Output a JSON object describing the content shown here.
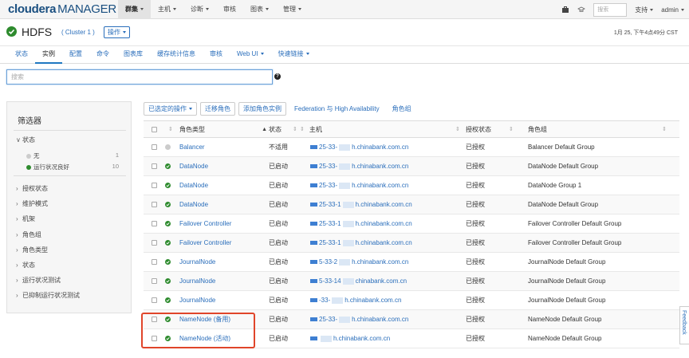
{
  "logo": {
    "brand": "cloudera",
    "product": "MANAGER"
  },
  "topnav": [
    {
      "label": "群集",
      "caret": true,
      "active": true
    },
    {
      "label": "主机",
      "caret": true
    },
    {
      "label": "诊断",
      "caret": true
    },
    {
      "label": "审核",
      "caret": false
    },
    {
      "label": "图表",
      "caret": true
    },
    {
      "label": "管理",
      "caret": true
    }
  ],
  "topright": {
    "search_placeholder": "搜索",
    "support": "支持",
    "user": "admin"
  },
  "service": {
    "name": "HDFS",
    "cluster": "( Cluster 1 )",
    "ops_label": "操作",
    "time": "1月 25, 下午4点49分 CST"
  },
  "subtabs": [
    {
      "label": "状态"
    },
    {
      "label": "实例",
      "active": true
    },
    {
      "label": "配置"
    },
    {
      "label": "命令"
    },
    {
      "label": "图表库"
    },
    {
      "label": "缓存统计信息"
    },
    {
      "label": "审核"
    },
    {
      "label": "Web UI",
      "caret": true
    },
    {
      "label": "快速链接",
      "caret": true
    }
  ],
  "search": {
    "placeholder": "搜索"
  },
  "filter": {
    "title": "筛选器",
    "status_section": "状态",
    "status_items": [
      {
        "label": "无",
        "count": "1"
      },
      {
        "label": "运行状况良好",
        "count": "10"
      }
    ],
    "sections": [
      "授权状态",
      "维护模式",
      "机架",
      "角色组",
      "角色类型",
      "状态",
      "运行状况测试",
      "已抑制运行状况测试"
    ]
  },
  "actions": {
    "selected_ops": "已选定的操作",
    "migrate": "迁移角色",
    "add_instance": "添加角色实例",
    "federation": "Federation 与 High Availability",
    "role_group": "角色组"
  },
  "table": {
    "headers": {
      "role_type": "角色类型",
      "status": "状态",
      "host": "主机",
      "auth": "授权状态",
      "group": "角色组"
    },
    "rows": [
      {
        "icon": "na",
        "role": "Balancer",
        "status": "不适用",
        "host_a": "25-33-",
        "host_b": "h.chinabank.com.cn",
        "auth": "已授权",
        "group": "Balancer Default Group"
      },
      {
        "icon": "ok",
        "role": "DataNode",
        "status": "已启动",
        "host_a": "25-33-",
        "host_b": "h.chinabank.com.cn",
        "auth": "已授权",
        "group": "DataNode Default Group"
      },
      {
        "icon": "ok",
        "role": "DataNode",
        "status": "已启动",
        "host_a": "25-33-",
        "host_b": "h.chinabank.com.cn",
        "auth": "已授权",
        "group": "DataNode Group 1"
      },
      {
        "icon": "ok",
        "role": "DataNode",
        "status": "已启动",
        "host_a": "25-33-1",
        "host_b": "h.chinabank.com.cn",
        "auth": "已授权",
        "group": "DataNode Default Group"
      },
      {
        "icon": "ok",
        "role": "Failover Controller",
        "status": "已启动",
        "host_a": "25-33-1",
        "host_b": "h.chinabank.com.cn",
        "auth": "已授权",
        "group": "Failover Controller Default Group"
      },
      {
        "icon": "ok",
        "role": "Failover Controller",
        "status": "已启动",
        "host_a": "25-33-1",
        "host_b": "h.chinabank.com.cn",
        "auth": "已授权",
        "group": "Failover Controller Default Group"
      },
      {
        "icon": "ok",
        "role": "JournalNode",
        "status": "已启动",
        "host_a": "5-33-2",
        "host_b": "h.chinabank.com.cn",
        "auth": "已授权",
        "group": "JournalNode Default Group"
      },
      {
        "icon": "ok",
        "role": "JournalNode",
        "status": "已启动",
        "host_a": "5-33-14",
        "host_b": "chinabank.com.cn",
        "auth": "已授权",
        "group": "JournalNode Default Group"
      },
      {
        "icon": "ok",
        "role": "JournalNode",
        "status": "已启动",
        "host_a": "-33-",
        "host_b": "h.chinabank.com.cn",
        "auth": "已授权",
        "group": "JournalNode Default Group"
      },
      {
        "icon": "ok",
        "role": "NameNode (备用)",
        "status": "已启动",
        "host_a": "25-33-",
        "host_b": "h.chinabank.com.cn",
        "auth": "已授权",
        "group": "NameNode Default Group"
      },
      {
        "icon": "ok",
        "role": "NameNode (活动)",
        "status": "已启动",
        "host_a": "",
        "host_b": "h.chinabank.com.cn",
        "auth": "已授权",
        "group": "NameNode Default Group"
      }
    ]
  },
  "feedback": "Feedback"
}
